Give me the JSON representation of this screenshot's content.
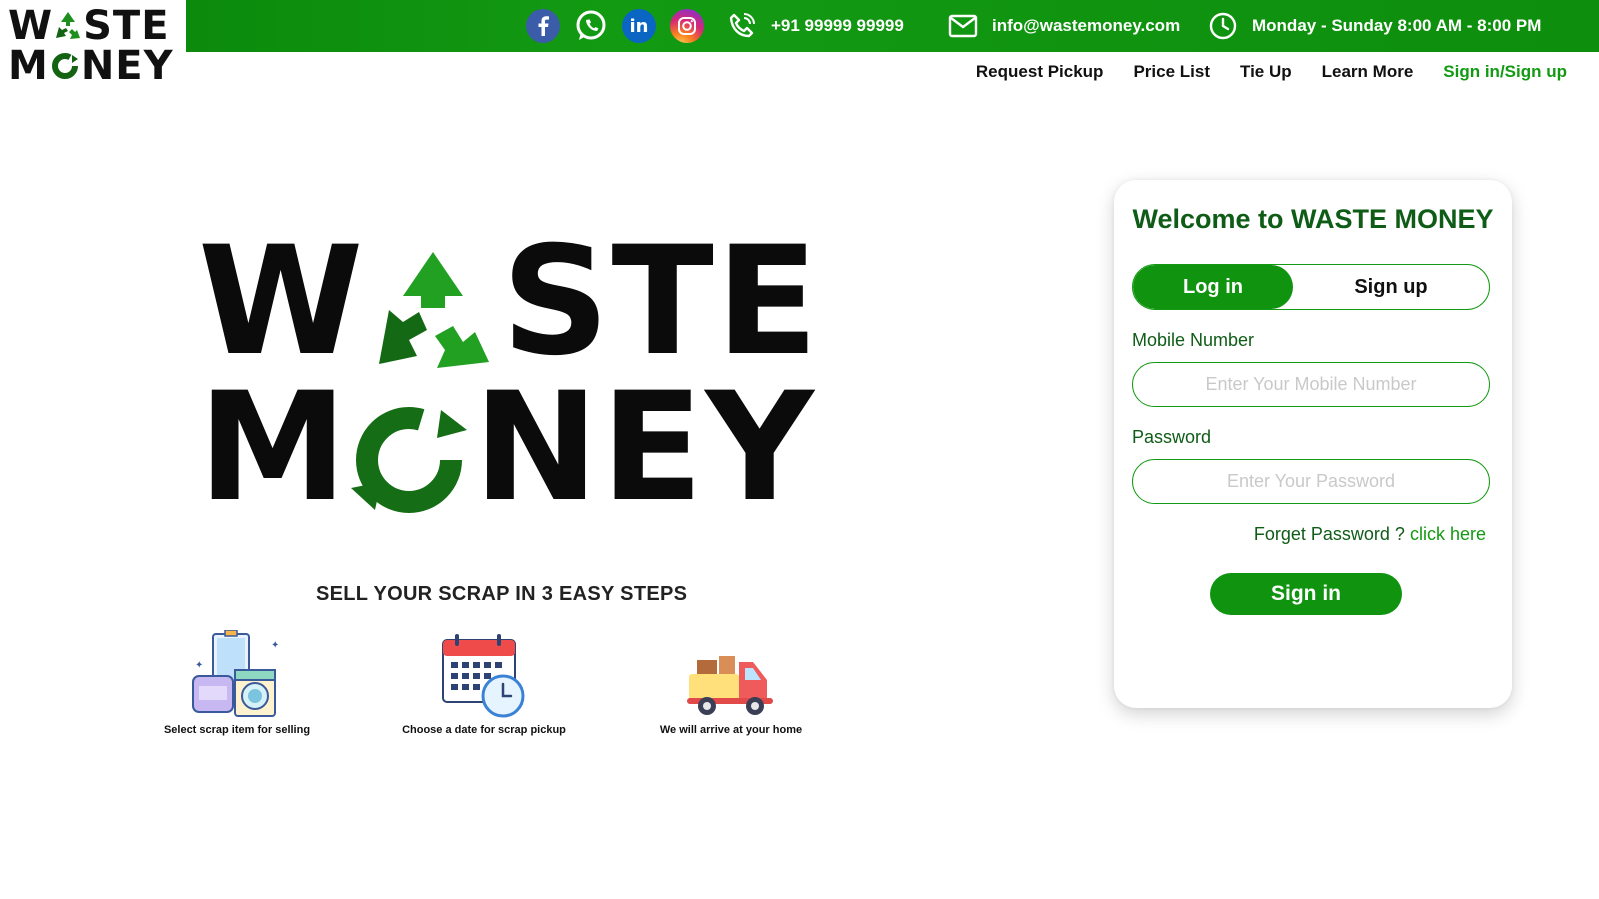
{
  "brand": {
    "line1_a": "W",
    "line1_b": "STE",
    "line2_a": "M",
    "line2_b": "NEY"
  },
  "topbar": {
    "phone": "+91 99999 99999",
    "email": "info@wastemoney.com",
    "hours": "Monday - Sunday 8:00 AM - 8:00 PM",
    "social": [
      "facebook-icon",
      "whatsapp-icon",
      "linkedin-icon",
      "instagram-icon"
    ]
  },
  "nav": {
    "items": [
      "Request Pickup",
      "Price List",
      "Tie Up",
      "Learn More",
      "Sign in/Sign up"
    ]
  },
  "hero": {
    "line1_a": "W",
    "line1_b": "STE",
    "line2_a": "M",
    "line2_b": "NEY"
  },
  "steps": {
    "title": "SELL YOUR SCRAP IN 3 EASY STEPS",
    "items": [
      {
        "caption": "Select scrap item for selling",
        "icon": "furniture-appliance-icon"
      },
      {
        "caption": "Choose a date for scrap pickup",
        "icon": "calendar-clock-icon"
      },
      {
        "caption": "We will arrive at your home",
        "icon": "truck-icon"
      }
    ]
  },
  "login": {
    "title": "Welcome to WASTE MONEY",
    "tab_login": "Log in",
    "tab_signup": "Sign up",
    "mobile_label": "Mobile Number",
    "mobile_placeholder": "Enter Your Mobile Number",
    "password_label": "Password",
    "password_placeholder": "Enter Your Password",
    "forgot_text": "Forget Password ?",
    "forgot_link": "click here",
    "submit": "Sign in"
  },
  "colors": {
    "brand_green": "#139a13",
    "dark_green": "#0f5c17",
    "recycle_green": "#1d7a1d"
  }
}
